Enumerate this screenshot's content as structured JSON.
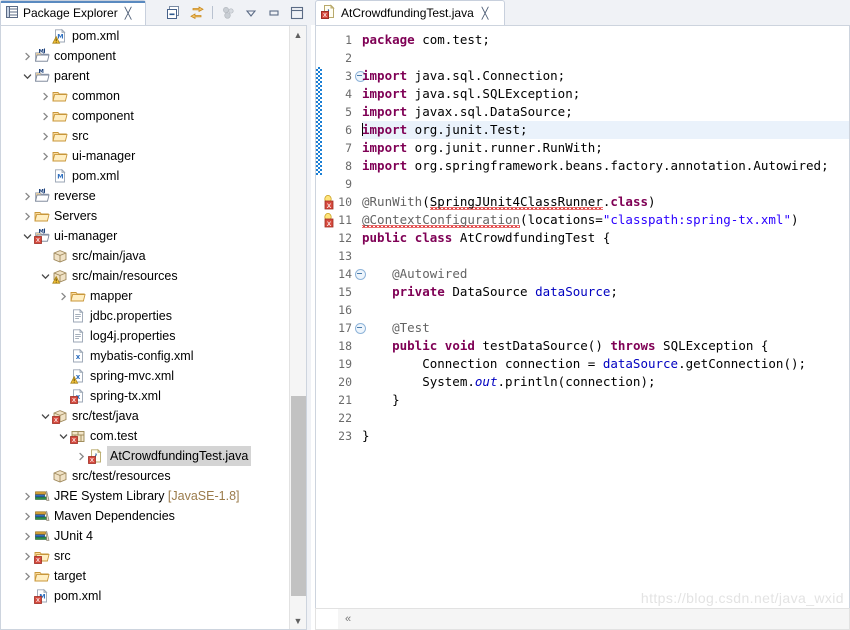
{
  "window": {
    "accent_color": "#5a8ac0",
    "watermark": "https://blog.csdn.net/java_wxid"
  },
  "package_explorer": {
    "tab_label": "Package Explorer",
    "close_glyph": "╳",
    "toolbar": [
      {
        "name": "collapse-all-icon",
        "tooltip": "Collapse All"
      },
      {
        "name": "link-with-editor-icon",
        "tooltip": "Link with Editor"
      },
      {
        "name": "view-menu-focus-icon",
        "tooltip": "Focus on Active Task"
      },
      {
        "name": "view-menu-icon",
        "tooltip": "View Menu"
      },
      {
        "name": "minimize-icon",
        "tooltip": "Minimize"
      },
      {
        "name": "maximize-icon",
        "tooltip": "Maximize"
      }
    ],
    "tree": [
      {
        "label": "pom.xml",
        "indent": 2,
        "twisty": "",
        "icon": "maven-pom-warning",
        "selected": false
      },
      {
        "label": "component",
        "indent": 1,
        "twisty": "right",
        "icon": "maven-project-java",
        "selected": false
      },
      {
        "label": "parent",
        "indent": 1,
        "twisty": "down",
        "icon": "maven-project",
        "selected": false
      },
      {
        "label": "common",
        "indent": 2,
        "twisty": "right",
        "icon": "folder",
        "selected": false
      },
      {
        "label": "component",
        "indent": 2,
        "twisty": "right",
        "icon": "folder",
        "selected": false
      },
      {
        "label": "src",
        "indent": 2,
        "twisty": "right",
        "icon": "folder",
        "selected": false
      },
      {
        "label": "ui-manager",
        "indent": 2,
        "twisty": "right",
        "icon": "folder",
        "selected": false
      },
      {
        "label": "pom.xml",
        "indent": 2,
        "twisty": "",
        "icon": "maven-pom",
        "selected": false
      },
      {
        "label": "reverse",
        "indent": 1,
        "twisty": "right",
        "icon": "maven-project-java",
        "selected": false
      },
      {
        "label": "Servers",
        "indent": 1,
        "twisty": "right",
        "icon": "folder",
        "selected": false
      },
      {
        "label": "ui-manager",
        "indent": 1,
        "twisty": "down",
        "icon": "maven-project-error",
        "selected": false
      },
      {
        "label": "src/main/java",
        "indent": 2,
        "twisty": "",
        "icon": "source-folder",
        "selected": false
      },
      {
        "label": "src/main/resources",
        "indent": 2,
        "twisty": "down",
        "icon": "source-folder-warning",
        "selected": false
      },
      {
        "label": "mapper",
        "indent": 3,
        "twisty": "right",
        "icon": "folder",
        "selected": false
      },
      {
        "label": "jdbc.properties",
        "indent": 3,
        "twisty": "",
        "icon": "file",
        "selected": false
      },
      {
        "label": "log4j.properties",
        "indent": 3,
        "twisty": "",
        "icon": "file",
        "selected": false
      },
      {
        "label": "mybatis-config.xml",
        "indent": 3,
        "twisty": "",
        "icon": "xml-file",
        "selected": false
      },
      {
        "label": "spring-mvc.xml",
        "indent": 3,
        "twisty": "",
        "icon": "xml-file-warning",
        "selected": false
      },
      {
        "label": "spring-tx.xml",
        "indent": 3,
        "twisty": "",
        "icon": "xml-file-error",
        "selected": false
      },
      {
        "label": "src/test/java",
        "indent": 2,
        "twisty": "down",
        "icon": "source-folder-error",
        "selected": false
      },
      {
        "label": "com.test",
        "indent": 3,
        "twisty": "down",
        "icon": "package-error",
        "selected": false
      },
      {
        "label": "AtCrowdfundingTest.java",
        "indent": 4,
        "twisty": "right",
        "icon": "java-file-error",
        "selected": true
      },
      {
        "label": "src/test/resources",
        "indent": 2,
        "twisty": "",
        "icon": "source-folder",
        "selected": false
      },
      {
        "label": "JRE System Library",
        "suffix": " [JavaSE-1.8]",
        "indent": 1,
        "twisty": "right",
        "icon": "library",
        "selected": false
      },
      {
        "label": "Maven Dependencies",
        "indent": 1,
        "twisty": "right",
        "icon": "library",
        "selected": false
      },
      {
        "label": "JUnit 4",
        "indent": 1,
        "twisty": "right",
        "icon": "library",
        "selected": false
      },
      {
        "label": "src",
        "indent": 1,
        "twisty": "right",
        "icon": "folder-error",
        "selected": false
      },
      {
        "label": "target",
        "indent": 1,
        "twisty": "right",
        "icon": "folder",
        "selected": false
      },
      {
        "label": "pom.xml",
        "indent": 1,
        "twisty": "",
        "icon": "maven-pom-error",
        "selected": false
      }
    ]
  },
  "editor": {
    "tab_label": "AtCrowdfundingTest.java",
    "tab_icon": "java-file-error-icon",
    "close_glyph": "╳",
    "highlighted_line": 6,
    "change_bar_lines": [
      3,
      4,
      5,
      6,
      7,
      8
    ],
    "fold_lines": [
      3,
      14,
      17
    ],
    "error_lines": [
      10,
      11
    ],
    "lines": [
      {
        "n": 1,
        "html": "<span class=\"kw\">package</span> com.test;"
      },
      {
        "n": 2,
        "html": ""
      },
      {
        "n": 3,
        "html": "<span class=\"kw\">import</span> java.sql.Connection;"
      },
      {
        "n": 4,
        "html": "<span class=\"kw\">import</span> java.sql.SQLException;"
      },
      {
        "n": 5,
        "html": "<span class=\"kw\">import</span> javax.sql.DataSource;"
      },
      {
        "n": 6,
        "html": "<span class=\"caret\"></span><span class=\"kw\">import</span> org.junit.Test;"
      },
      {
        "n": 7,
        "html": "<span class=\"kw\">import</span> org.junit.runner.RunWith;"
      },
      {
        "n": 8,
        "html": "<span class=\"kw\">import</span> org.springframework.beans.factory.annotation.Autowired;"
      },
      {
        "n": 9,
        "html": ""
      },
      {
        "n": 10,
        "html": "<span class=\"ann\">@RunWith</span>(<span class=\"squig\">SpringJUnit4ClassRunner</span>.<span class=\"kw\">class</span>)"
      },
      {
        "n": 11,
        "html": "<span class=\"ann squig\">@ContextConfiguration</span>(locations=<span class=\"str\">\"classpath:spring-tx.xml\"</span>)"
      },
      {
        "n": 12,
        "html": "<span class=\"kw\">public</span> <span class=\"kw\">class</span> AtCrowdfundingTest {"
      },
      {
        "n": 13,
        "html": ""
      },
      {
        "n": 14,
        "html": "    <span class=\"ann\">@Autowired</span>"
      },
      {
        "n": 15,
        "html": "    <span class=\"kw\">private</span> DataSource <span class=\"fld\">dataSource</span>;"
      },
      {
        "n": 16,
        "html": ""
      },
      {
        "n": 17,
        "html": "    <span class=\"ann\">@Test</span>"
      },
      {
        "n": 18,
        "html": "    <span class=\"kw\">public</span> <span class=\"kw\">void</span> testDataSource() <span class=\"kw\">throws</span> SQLException {"
      },
      {
        "n": 19,
        "html": "        Connection connection = <span class=\"fld\">dataSource</span>.getConnection();"
      },
      {
        "n": 20,
        "html": "        System.<span class=\"sfld\">out</span>.println(connection);"
      },
      {
        "n": 21,
        "html": "    }"
      },
      {
        "n": 22,
        "html": ""
      },
      {
        "n": 23,
        "html": "}"
      }
    ],
    "code_plain": [
      "package com.test;",
      "",
      "import java.sql.Connection;",
      "import java.sql.SQLException;",
      "import javax.sql.DataSource;",
      "import org.junit.Test;",
      "import org.junit.runner.RunWith;",
      "import org.springframework.beans.factory.annotation.Autowired;",
      "",
      "@RunWith(SpringJUnit4ClassRunner.class)",
      "@ContextConfiguration(locations=\"classpath:spring-tx.xml\")",
      "public class AtCrowdfundingTest {",
      "",
      "    @Autowired",
      "    private DataSource dataSource;",
      "",
      "    @Test",
      "    public void testDataSource() throws SQLException {",
      "        Connection connection = dataSource.getConnection();",
      "        System.out.println(connection);",
      "    }",
      "",
      "}"
    ],
    "hscroll_arrow": "«"
  }
}
